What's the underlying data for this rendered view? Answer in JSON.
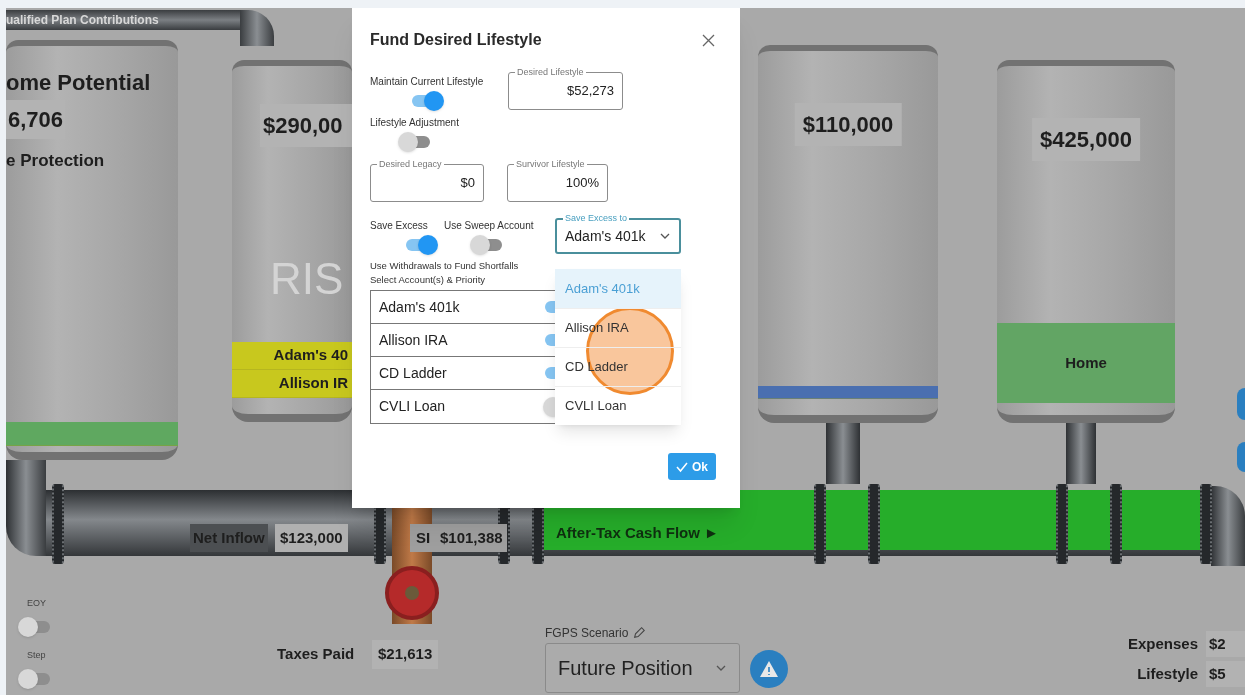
{
  "top_pipe": {
    "label": "ualified Plan Contributions"
  },
  "tanks": [
    {
      "title": "ome Potential",
      "value": "6,706",
      "subtitle": "e Protection",
      "segments": [
        {
          "color": "#5fa860"
        }
      ]
    },
    {
      "value": "$290,00",
      "watermark": "RIS",
      "segments": [
        {
          "label": "Adam's 40",
          "color": "#c8c81e"
        },
        {
          "label": "Allison IR",
          "color": "#c8c81e"
        }
      ]
    },
    {
      "value": "$110,000",
      "segments": [
        {
          "color": "#4a6fb0"
        }
      ]
    },
    {
      "value": "$425,000",
      "segments": [
        {
          "label": "Home",
          "color": "#62a564"
        }
      ]
    }
  ],
  "pipe": {
    "net_inflow": {
      "label": "Net Inflow",
      "value": "$123,000"
    },
    "si": {
      "label": "SI",
      "value": "$101,388"
    },
    "flow_label": "After-Tax Cash Flow ►",
    "taxes_paid": {
      "label": "Taxes Paid",
      "value": "$21,613"
    }
  },
  "switches": [
    {
      "label": "EOY",
      "on": false
    },
    {
      "label": "Step",
      "on": false
    }
  ],
  "scenario": {
    "label": "FGPS Scenario",
    "value": "Future Position"
  },
  "totals": [
    {
      "label": "Expenses",
      "value": "$2"
    },
    {
      "label": "Lifestyle",
      "value": "$5"
    }
  ],
  "dialog": {
    "title": "Fund Desired Lifestyle",
    "maintain_current_lifestyle": {
      "label": "Maintain Current Lifestyle",
      "on": true
    },
    "desired_lifestyle": {
      "label": "Desired Lifestyle",
      "value": "$52,273"
    },
    "lifestyle_adjustment": {
      "label": "Lifestyle Adjustment",
      "on": false
    },
    "desired_legacy": {
      "label": "Desired Legacy",
      "value": "$0"
    },
    "survivor_lifestyle": {
      "label": "Survivor Lifestyle",
      "value": "100%"
    },
    "save_excess": {
      "label": "Save Excess",
      "on": true
    },
    "use_sweep_account": {
      "label": "Use Sweep Account",
      "on": false
    },
    "save_excess_to": {
      "label": "Save Excess to",
      "value": "Adam's 401k",
      "options": [
        {
          "label": "Adam's 401k",
          "selected": true
        },
        {
          "label": "Allison IRA",
          "selected": false
        },
        {
          "label": "CD Ladder",
          "selected": false
        },
        {
          "label": "CVLI Loan",
          "selected": false
        }
      ]
    },
    "withdrawals_note": [
      "Use Withdrawals to Fund Shortfalls",
      "Select Account(s) & Priority"
    ],
    "withdrawal_accounts": [
      {
        "label": "Adam's 401k",
        "on": true
      },
      {
        "label": "Allison IRA",
        "on": true
      },
      {
        "label": "CD Ladder",
        "on": true
      },
      {
        "label": "CVLI Loan",
        "on": false
      }
    ],
    "ok_button": "Ok"
  }
}
